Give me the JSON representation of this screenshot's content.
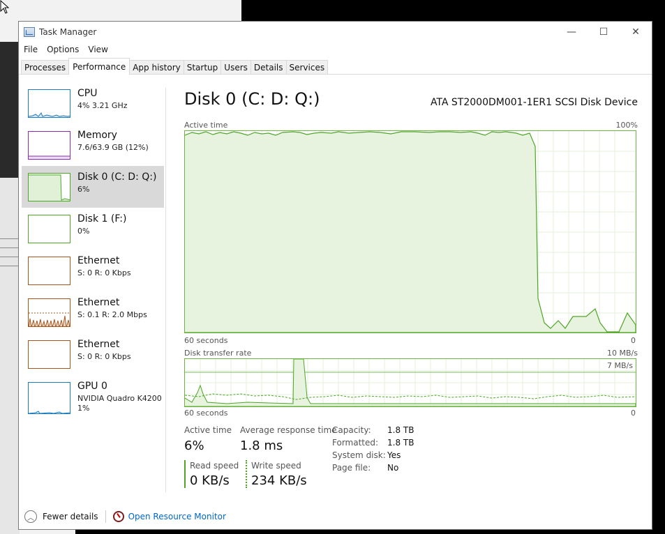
{
  "window": {
    "title": "Task Manager",
    "minimize_glyph": "—",
    "maximize_glyph": "☐",
    "close_glyph": "✕"
  },
  "menu": [
    "File",
    "Options",
    "View"
  ],
  "tabs": [
    {
      "label": "Processes",
      "active": false
    },
    {
      "label": "Performance",
      "active": true
    },
    {
      "label": "App history",
      "active": false
    },
    {
      "label": "Startup",
      "active": false
    },
    {
      "label": "Users",
      "active": false
    },
    {
      "label": "Details",
      "active": false
    },
    {
      "label": "Services",
      "active": false
    }
  ],
  "sidebar": {
    "items": [
      {
        "name": "CPU",
        "sub": "4% 3.21 GHz",
        "color": "#1a7bbf"
      },
      {
        "name": "Memory",
        "sub": "7.6/63.9 GB (12%)",
        "color": "#8b2bb0"
      },
      {
        "name": "Disk 0 (C: D: Q:)",
        "sub": "6%",
        "color": "#4da627"
      },
      {
        "name": "Disk 1 (F:)",
        "sub": "0%",
        "color": "#4da627"
      },
      {
        "name": "Ethernet",
        "sub": "S: 0 R: 0 Kbps",
        "color": "#a7541c"
      },
      {
        "name": "Ethernet",
        "sub": "S: 0.1 R: 2.0 Mbps",
        "color": "#a7541c"
      },
      {
        "name": "Ethernet",
        "sub": "S: 0 R: 0 Kbps",
        "color": "#a7541c"
      },
      {
        "name": "GPU 0",
        "sub": "NVIDIA Quadro K4200",
        "sub2": "1%",
        "color": "#1a7bbf"
      }
    ]
  },
  "main": {
    "title": "Disk 0 (C: D: Q:)",
    "model": "ATA ST2000DM001-1ER1 SCSI Disk Device",
    "active_graph": {
      "label": "Active time",
      "max_label": "100%",
      "time_label": "60 seconds",
      "min_label": "0"
    },
    "transfer_graph": {
      "label": "Disk transfer rate",
      "max_label": "10 MB/s",
      "inner_label": "7 MB/s",
      "time_label": "60 seconds",
      "min_label": "0"
    },
    "stats": {
      "active_time_label": "Active time",
      "active_time_value": "6%",
      "avg_resp_label": "Average response time",
      "avg_resp_value": "1.8 ms",
      "read_label": "Read speed",
      "read_value": "0 KB/s",
      "write_label": "Write speed",
      "write_value": "234 KB/s"
    },
    "props": [
      {
        "k": "Capacity:",
        "v": "1.8 TB"
      },
      {
        "k": "Formatted:",
        "v": "1.8 TB"
      },
      {
        "k": "System disk:",
        "v": "Yes"
      },
      {
        "k": "Page file:",
        "v": "No"
      }
    ]
  },
  "footer": {
    "fewer": "Fewer details",
    "resmon": "Open Resource Monitor"
  }
}
